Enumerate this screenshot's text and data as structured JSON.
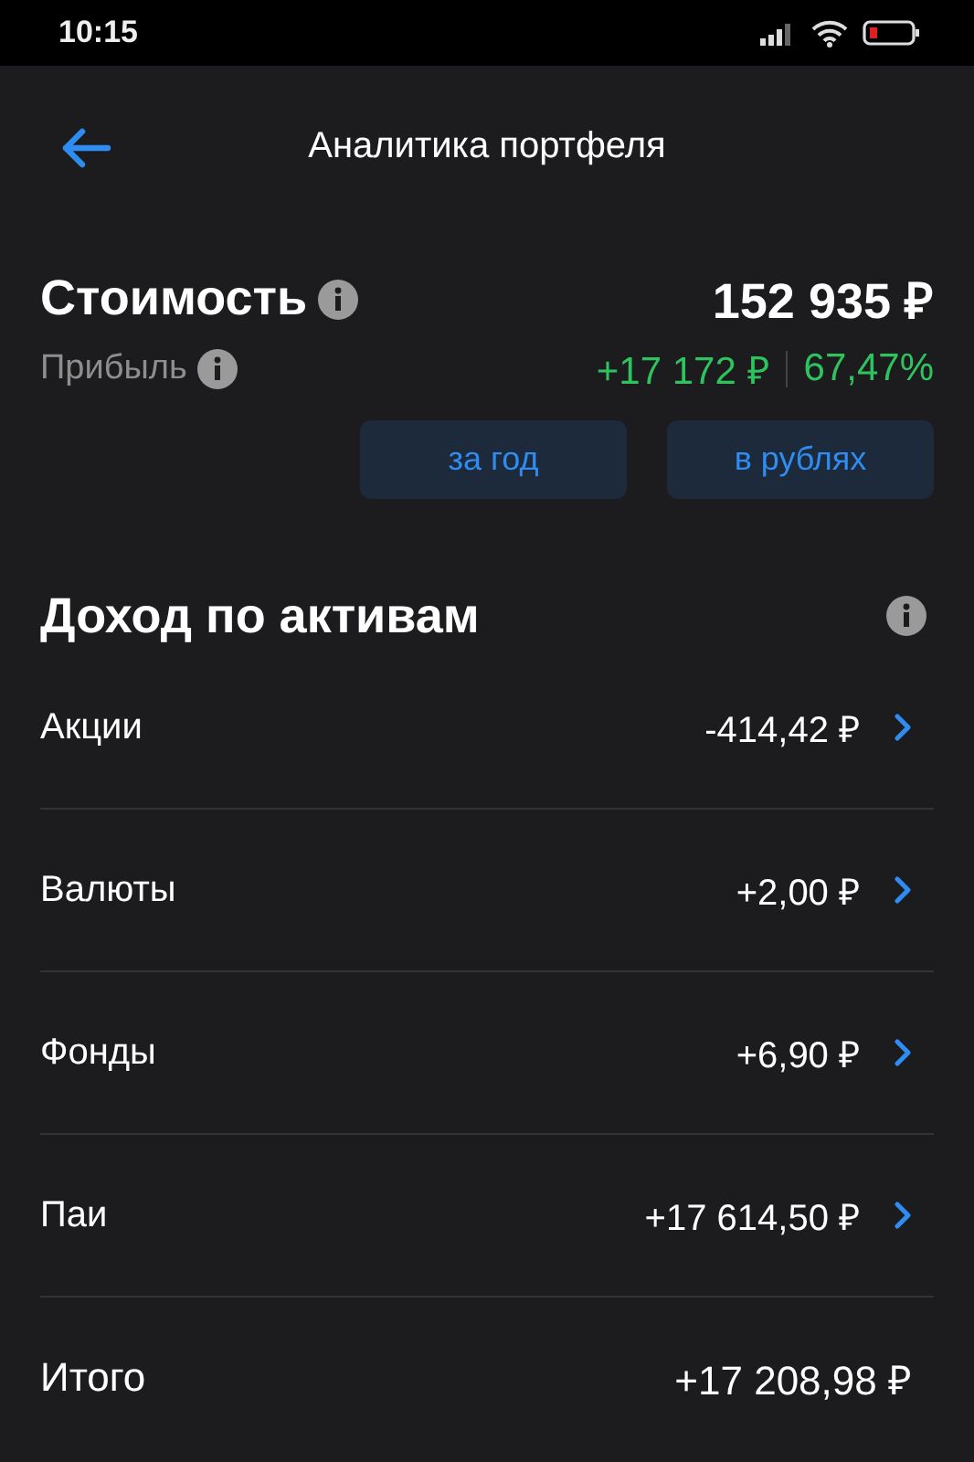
{
  "status_bar": {
    "time": "10:15"
  },
  "header": {
    "title": "Аналитика портфеля"
  },
  "summary": {
    "value_label": "Стоимость",
    "value": "152 935 ₽",
    "profit_label": "Прибыль",
    "profit": "+17 172 ₽",
    "profit_percent": "67,47%"
  },
  "filters": [
    {
      "label": "за год"
    },
    {
      "label": "в рублях"
    }
  ],
  "section": {
    "title": "Доход по активам"
  },
  "rows": [
    {
      "kind": "asset",
      "label": "Акции",
      "value": "-414,42 ₽"
    },
    {
      "kind": "asset",
      "label": "Валюты",
      "value": "+2,00 ₽"
    },
    {
      "kind": "asset",
      "label": "Фонды",
      "value": "+6,90 ₽"
    },
    {
      "kind": "asset",
      "label": "Паи",
      "value": "+17 614,50 ₽"
    },
    {
      "kind": "total",
      "label": "Итого",
      "value": "+17 208,98 ₽"
    }
  ]
}
